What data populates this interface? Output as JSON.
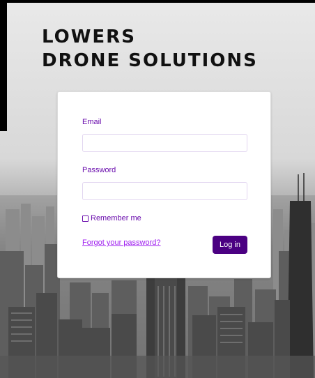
{
  "brand": {
    "line1": "LOWERS",
    "line2": "DRONE SOLUTIONS"
  },
  "login": {
    "email_label": "Email",
    "email_value": "",
    "password_label": "Password",
    "password_value": "",
    "remember_label": "Remember me",
    "remember_checked": false,
    "forgot_label": "Forgot your password?",
    "login_label": "Log in"
  },
  "colors": {
    "accent": "#6a0dad",
    "button": "#4b0082",
    "link": "#a020f0"
  }
}
